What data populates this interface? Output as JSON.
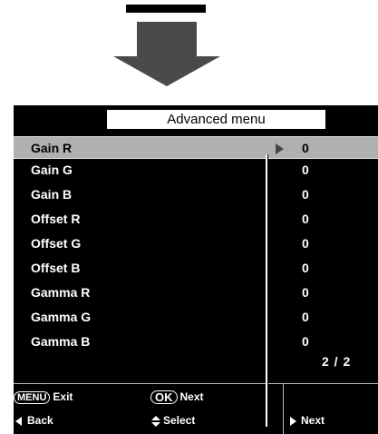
{
  "menu": {
    "title": "Advanced menu",
    "rows": [
      {
        "label": "Gain R",
        "value": "0",
        "selected": true
      },
      {
        "label": "Gain G",
        "value": "0"
      },
      {
        "label": "Gain B",
        "value": "0"
      },
      {
        "label": "Offset R",
        "value": "0"
      },
      {
        "label": "Offset G",
        "value": "0"
      },
      {
        "label": "Offset B",
        "value": "0"
      },
      {
        "label": "Gamma R",
        "value": "0"
      },
      {
        "label": "Gamma G",
        "value": "0"
      },
      {
        "label": "Gamma B",
        "value": "0"
      }
    ],
    "page_indicator": "2 / 2"
  },
  "help": {
    "menu_key": "MENU",
    "exit_label": "Exit",
    "ok_key": "OK",
    "next_label": "Next",
    "back_label": "Back",
    "select_label": "Select",
    "next_right_label": "Next"
  },
  "icons": {
    "top": "down-arrow-icon",
    "row": "right-arrow-icon",
    "back": "left-triangle-icon",
    "select": "up-down-icon",
    "next": "right-triangle-icon"
  },
  "colors": {
    "panel_background": "#000000",
    "selected_row": "#b0b0b0",
    "arrow_gray": "#4a4a4a",
    "text": "#ffffff"
  }
}
